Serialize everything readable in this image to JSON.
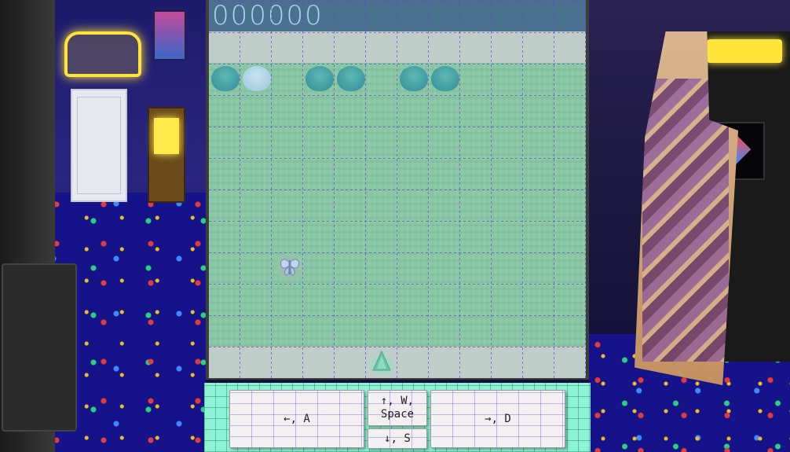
{
  "game": {
    "score": "000000"
  },
  "controls": {
    "left_label": "←, A",
    "up_label": "↑, W,\nSpace",
    "down_label": "↓, S",
    "right_label": "→, D"
  },
  "colors": {
    "score_bar": "#4b7190",
    "score_text": "#a8d4f0",
    "field": "#88c7a4",
    "safe_row": "#bfcdc8",
    "enemy_teal": "#3f9aa0",
    "enemy_light": "#a8cfe2",
    "controls_bg": "#8ef3d6",
    "grid_line": "#6e3cd2"
  },
  "sprites": {
    "enemies": [
      "enemy-teal",
      "enemy-light",
      "enemy-teal",
      "enemy-teal",
      "enemy-teal",
      "enemy-teal"
    ],
    "moth": "moth-icon",
    "player": "player-ship-icon"
  }
}
